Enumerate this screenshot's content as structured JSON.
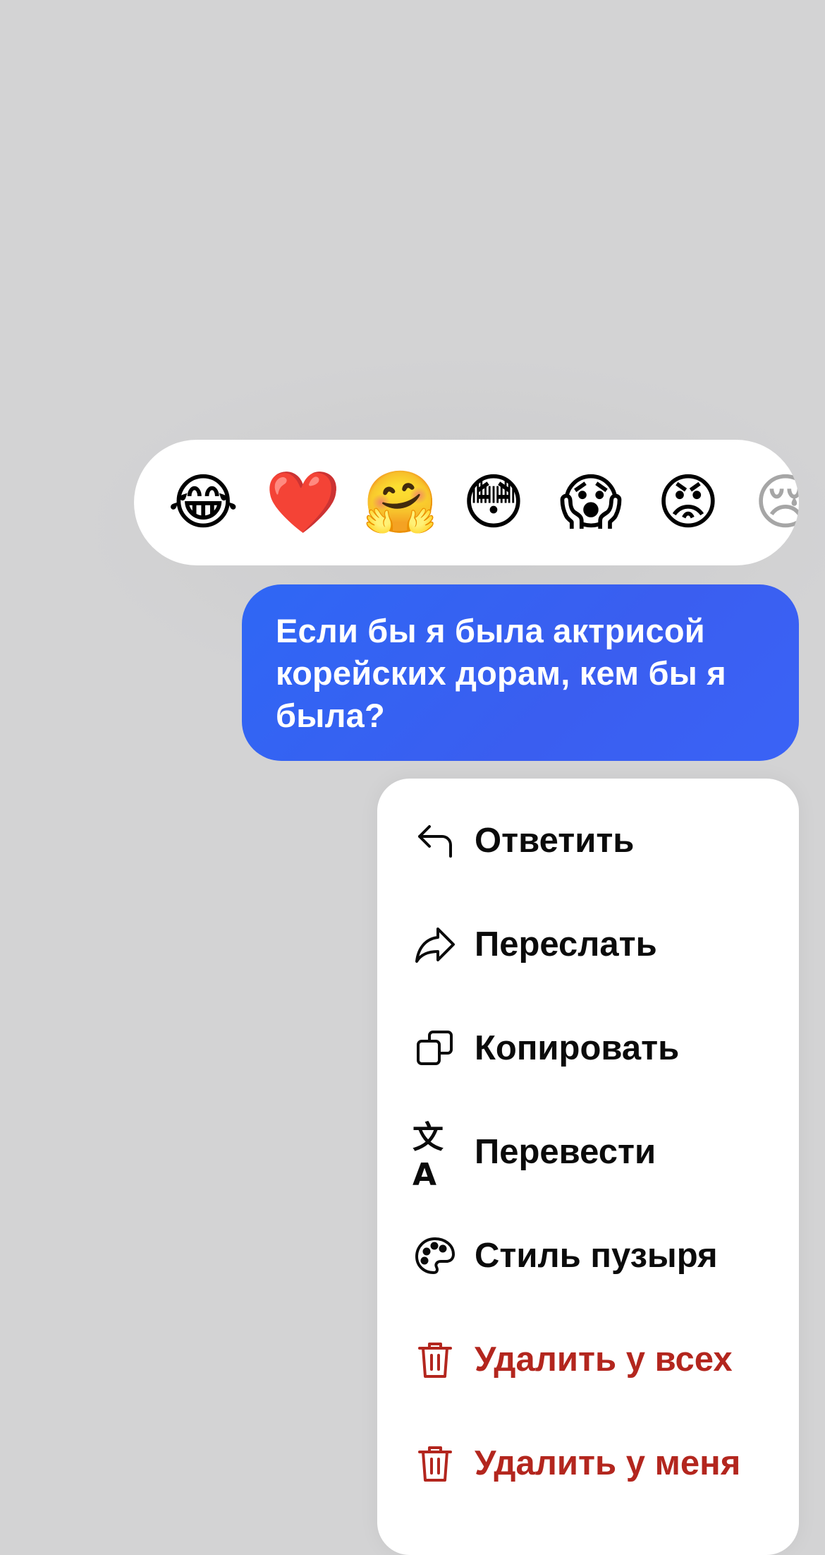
{
  "reactions": [
    {
      "emoji": "😂",
      "icon": "tears-of-joy-emoji"
    },
    {
      "emoji": "❤️",
      "icon": "red-heart-emoji"
    },
    {
      "emoji": "🤗",
      "icon": "hugging-face-emoji"
    },
    {
      "emoji": "😳",
      "icon": "flushed-face-emoji"
    },
    {
      "emoji": "😱",
      "icon": "screaming-face-emoji"
    },
    {
      "emoji": "😡",
      "icon": "angry-face-emoji"
    },
    {
      "emoji": "😢",
      "icon": "crying-face-emoji"
    }
  ],
  "message": {
    "text": "Если бы я была актрисой корейских дорам, кем бы я была?",
    "bubble_color": "#3461f4"
  },
  "menu": {
    "items": [
      {
        "label": "Ответить",
        "icon": "reply-icon"
      },
      {
        "label": "Переслать",
        "icon": "forward-icon"
      },
      {
        "label": "Копировать",
        "icon": "copy-icon"
      },
      {
        "label": "Перевести",
        "icon": "translate-icon",
        "icon_text": "文A"
      },
      {
        "label": "Стиль пузыря",
        "icon": "palette-icon"
      },
      {
        "label": "Удалить у всех",
        "icon": "trash-icon",
        "danger": true
      },
      {
        "label": "Удалить у меня",
        "icon": "trash-icon",
        "danger": true
      }
    ],
    "danger_color": "#b3261e"
  }
}
